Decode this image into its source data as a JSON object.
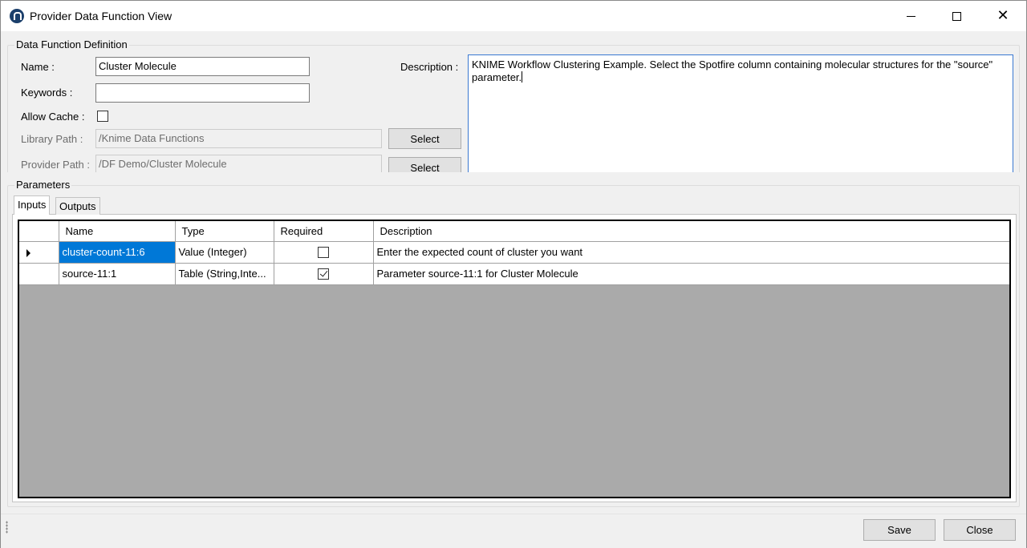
{
  "window": {
    "title": "Provider Data Function View",
    "icon": "knime-app-icon"
  },
  "definition": {
    "group_label": "Data Function Definition",
    "name_label": "Name :",
    "name_value": "Cluster Molecule",
    "keywords_label": "Keywords :",
    "keywords_value": "",
    "allow_cache_label": "Allow Cache :",
    "allow_cache_checked": false,
    "library_path_label": "Library Path :",
    "library_path_value": "/Knime Data Functions",
    "provider_path_label": "Provider Path :",
    "provider_path_value": "/DF Demo/Cluster Molecule",
    "select_label": "Select",
    "description_label": "Description :",
    "description_value": "KNIME Workflow Clustering Example. Select the Spotfire column containing molecular structures for the \"source\" parameter."
  },
  "parameters": {
    "group_label": "Parameters",
    "tabs": [
      {
        "label": "Inputs",
        "active": true
      },
      {
        "label": "Outputs",
        "active": false
      }
    ],
    "columns": [
      "Name",
      "Type",
      "Required",
      "Description"
    ],
    "rows": [
      {
        "name": "cluster-count-11:6",
        "type": "Value (Integer)",
        "required": false,
        "description": "Enter the expected count of cluster you want",
        "current": true
      },
      {
        "name": "source-11:1",
        "type": "Table (String,Inte...",
        "required": true,
        "description": "Parameter source-11:1 for Cluster Molecule",
        "current": false
      }
    ]
  },
  "footer": {
    "save_label": "Save",
    "close_label": "Close"
  }
}
